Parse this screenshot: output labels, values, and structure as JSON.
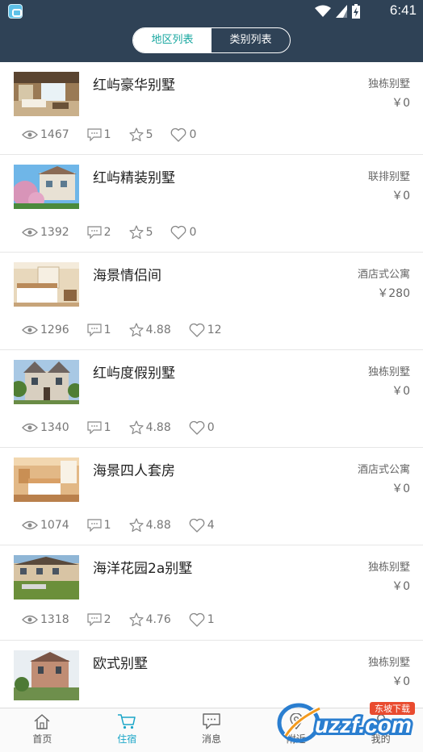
{
  "status_bar": {
    "time": "6:41",
    "icons": [
      "app-icon",
      "wifi-icon",
      "signal-icon",
      "battery-charging-icon"
    ]
  },
  "header": {
    "tabs": [
      {
        "label": "地区列表",
        "active": true
      },
      {
        "label": "类别列表",
        "active": false
      }
    ]
  },
  "listings": [
    {
      "title": "红屿豪华别墅",
      "type": "独栋别墅",
      "price": "￥0",
      "views": "1467",
      "comments": "1",
      "rating": "5",
      "likes": "0"
    },
    {
      "title": "红屿精装别墅",
      "type": "联排别墅",
      "price": "￥0",
      "views": "1392",
      "comments": "2",
      "rating": "5",
      "likes": "0"
    },
    {
      "title": "海景情侣间",
      "type": "酒店式公寓",
      "price": "￥280",
      "views": "1296",
      "comments": "1",
      "rating": "4.88",
      "likes": "12"
    },
    {
      "title": "红屿度假别墅",
      "type": "独栋别墅",
      "price": "￥0",
      "views": "1340",
      "comments": "1",
      "rating": "4.88",
      "likes": "0"
    },
    {
      "title": "海景四人套房",
      "type": "酒店式公寓",
      "price": "￥0",
      "views": "1074",
      "comments": "1",
      "rating": "4.88",
      "likes": "4"
    },
    {
      "title": "海洋花园2a别墅",
      "type": "独栋别墅",
      "price": "￥0",
      "views": "1318",
      "comments": "2",
      "rating": "4.76",
      "likes": "1"
    },
    {
      "title": "欧式别墅",
      "type": "独栋别墅",
      "price": "￥0"
    }
  ],
  "bottom_nav": [
    {
      "label": "首页",
      "icon": "home-icon",
      "active": false
    },
    {
      "label": "住宿",
      "icon": "cart-icon",
      "active": true
    },
    {
      "label": "消息",
      "icon": "message-icon",
      "active": false
    },
    {
      "label": "附近",
      "icon": "location-icon",
      "active": false
    },
    {
      "label": "我的",
      "icon": "user-icon",
      "active": false
    }
  ],
  "watermark": {
    "text": "uzzf.com",
    "subtext": "东坡下载"
  },
  "colors": {
    "header": "#2f4256",
    "accent": "#18a7a0",
    "nav_active": "#1ba6c8"
  }
}
